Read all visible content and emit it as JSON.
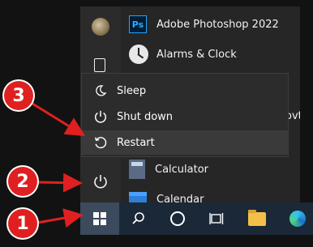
{
  "apps": [
    {
      "name": "Adobe Photoshop 2022",
      "icon": "photoshop-icon"
    },
    {
      "name": "Alarms & Clock",
      "icon": "alarm-clock-icon"
    },
    {
      "name": "Calculator",
      "icon": "calculator-icon"
    },
    {
      "name": "Calendar",
      "icon": "calendar-icon"
    }
  ],
  "ps_badge": "Ps",
  "partial_text": "ovt",
  "power_menu": [
    {
      "label": "Sleep",
      "icon": "moon-icon"
    },
    {
      "label": "Shut down",
      "icon": "power-icon"
    },
    {
      "label": "Restart",
      "icon": "restart-icon",
      "highlighted": true
    }
  ],
  "callouts": [
    "1",
    "2",
    "3"
  ],
  "colors": {
    "callout": "#e02020",
    "taskbar": "#1b2838",
    "start_menu": "#262626"
  }
}
